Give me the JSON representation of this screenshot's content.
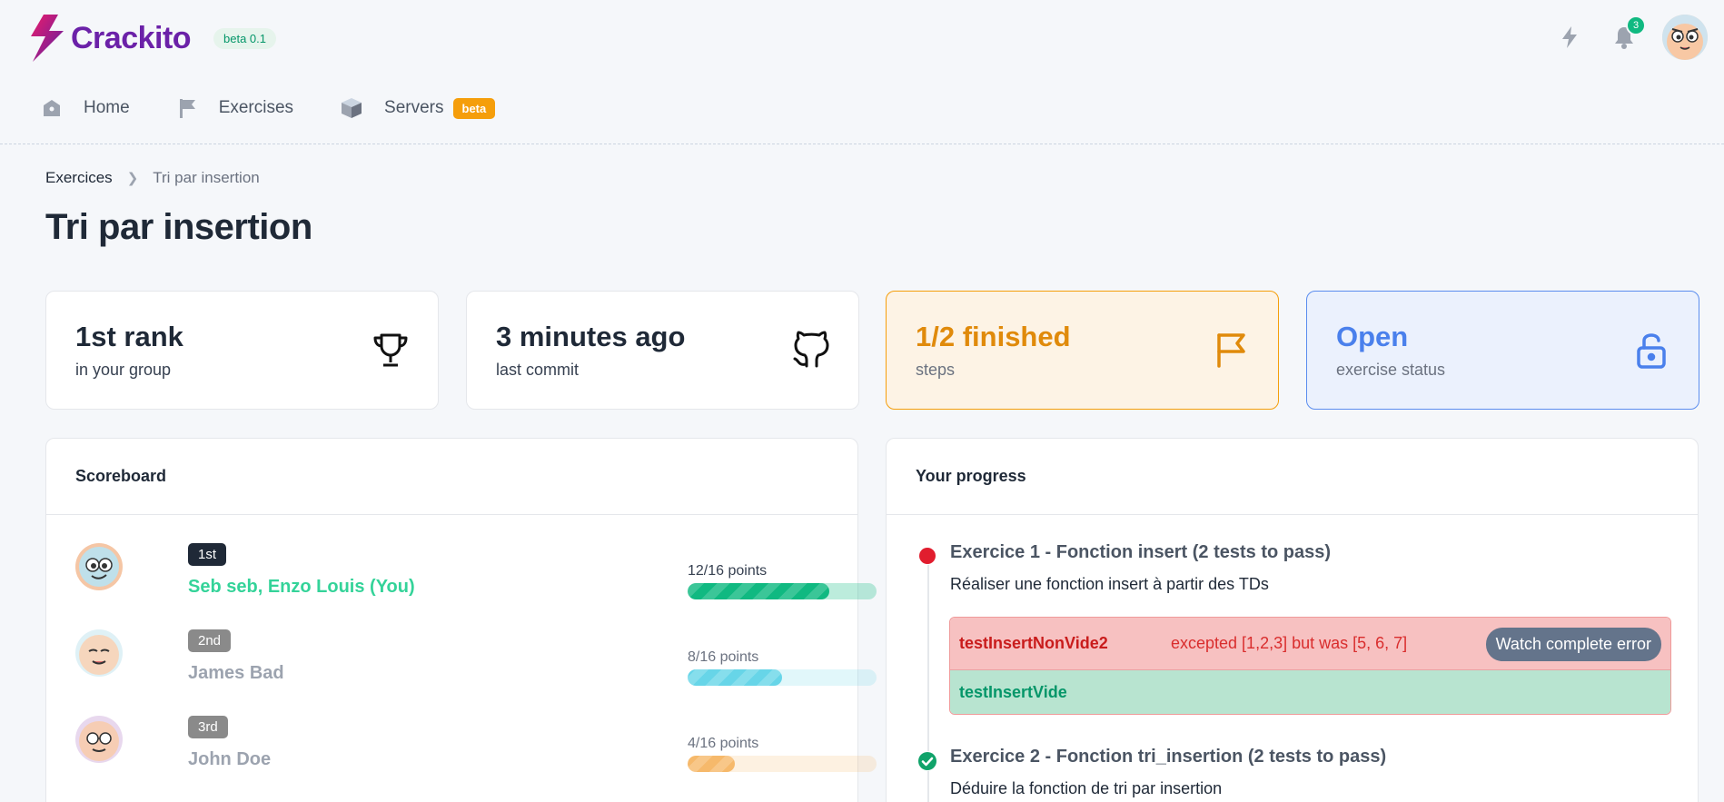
{
  "app": {
    "brand": "Crackito",
    "version_badge": "beta 0.1",
    "notification_count": "3"
  },
  "nav": {
    "items": [
      {
        "label": "Home",
        "icon": "home-icon"
      },
      {
        "label": "Exercises",
        "icon": "flag-icon"
      },
      {
        "label": "Servers",
        "icon": "cube-icon",
        "badge": "beta"
      }
    ]
  },
  "breadcrumb": {
    "root": "Exercices",
    "current": "Tri par insertion"
  },
  "page": {
    "title": "Tri par insertion"
  },
  "stats": [
    {
      "value": "1st rank",
      "label": "in your group",
      "icon": "trophy-icon"
    },
    {
      "value": "3 minutes ago",
      "label": "last commit",
      "icon": "github-icon"
    },
    {
      "value": "1/2 finished",
      "label": "steps",
      "icon": "flag-icon",
      "color": "#e08a0b"
    },
    {
      "value": "Open",
      "label": "exercise status",
      "icon": "unlock-icon",
      "color": "#4a80ec"
    }
  ],
  "scoreboard": {
    "title": "Scoreboard",
    "rows": [
      {
        "rank": "1st",
        "name": "Seb seb, Enzo Louis (You)",
        "points": "12/16 points",
        "progress": 0.75,
        "bar_color": "#10b981",
        "name_color": "#34d399"
      },
      {
        "rank": "2nd",
        "name": "James Bad",
        "points": "8/16 points",
        "progress": 0.5,
        "bar_color": "#67d5e8",
        "name_color": "#9ca3af"
      },
      {
        "rank": "3rd",
        "name": "John Doe",
        "points": "4/16 points",
        "progress": 0.25,
        "bar_color": "#f6b96b",
        "name_color": "#9ca3af"
      }
    ]
  },
  "progress": {
    "title": "Your progress",
    "steps": [
      {
        "title": "Exercice 1 - Fonction insert (2 tests to pass)",
        "description": "Réaliser une fonction insert à partir des TDs",
        "status": "failed",
        "tests": [
          {
            "name": "testInsertNonVide2",
            "message": "excepted [1,2,3] but was [5, 6, 7]",
            "action": "Watch complete error",
            "passed": false
          },
          {
            "name": "testInsertVide",
            "passed": true
          }
        ]
      },
      {
        "title": "Exercice 2 - Fonction tri_insertion (2 tests to pass)",
        "description": "Déduire la fonction de tri par insertion",
        "status": "passed"
      }
    ]
  }
}
